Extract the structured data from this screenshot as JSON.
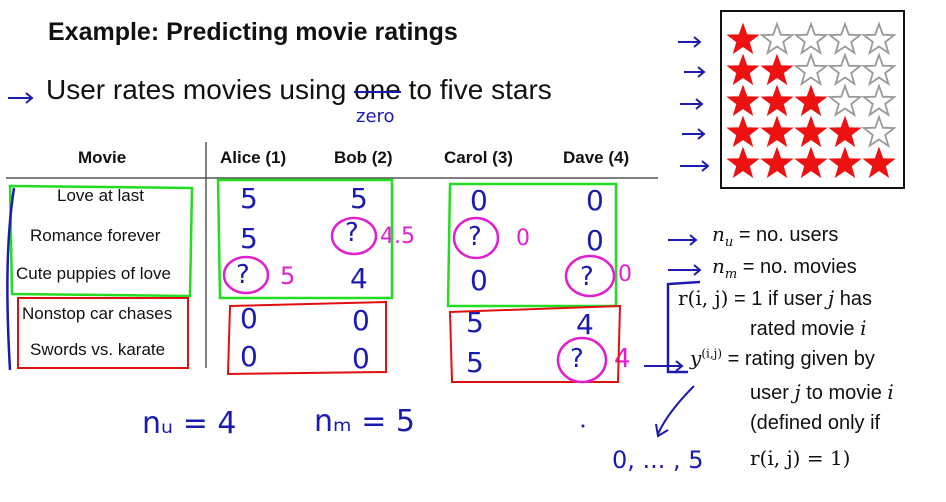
{
  "slide": {
    "title": "Example: Predicting movie ratings",
    "bullet_prefix": "User rates movies using ",
    "bullet_struck": "one",
    "bullet_suffix": " to five stars",
    "bullet_correction": "zero"
  },
  "table": {
    "headers": [
      "Movie",
      "Alice (1)",
      "Bob (2)",
      "Carol (3)",
      "Dave (4)"
    ],
    "movies": [
      "Love at last",
      "Romance forever",
      "Cute puppies of love",
      "Nonstop car chases",
      "Swords vs. karate"
    ],
    "ratings": [
      [
        "5",
        "5",
        "0",
        "0"
      ],
      [
        "5",
        "?",
        "?",
        "0"
      ],
      [
        "?",
        "4",
        "0",
        "?"
      ],
      [
        "0",
        "0",
        "5",
        "4"
      ],
      [
        "0",
        "0",
        "5",
        "?"
      ]
    ],
    "predictions": {
      "bob_romance": "4.5",
      "carol_romance": "0",
      "alice_puppies": "5",
      "dave_puppies": "0",
      "dave_swords": "4"
    }
  },
  "star_ratings": [
    1,
    2,
    3,
    4,
    5
  ],
  "colors": {
    "star_filled": "#ee1111",
    "star_empty": "#9a9a9a",
    "ink_blue": "#1b1bb0",
    "ink_pink": "#e020d0",
    "ink_green": "#22dd22",
    "ink_red": "#e01010"
  },
  "definitions": {
    "nu_sym": "n",
    "nu_sub": "u",
    "nu_text": " = no. users",
    "nm_sym": "n",
    "nm_sub": "m",
    "nm_text": " = no. movies",
    "r_sym": "r(i, j)",
    "r_text_1": " = 1 if user ",
    "r_j": "j",
    "r_text_2": " has",
    "r_text_3": "rated movie ",
    "r_i": "i",
    "y_sym": "y",
    "y_sup": "(i,j)",
    "y_text_1": " = rating given by",
    "y_text_2": "user ",
    "y_j": "j",
    "y_text_3": " to movie ",
    "y_i": "i",
    "y_text_4": "(defined only if",
    "y_cond": "r(i, j) = 1)"
  },
  "handwritten": {
    "nu_eq": "nᵤ = 4",
    "nm_eq": "nₘ = 5",
    "range": "0, ... , 5"
  }
}
